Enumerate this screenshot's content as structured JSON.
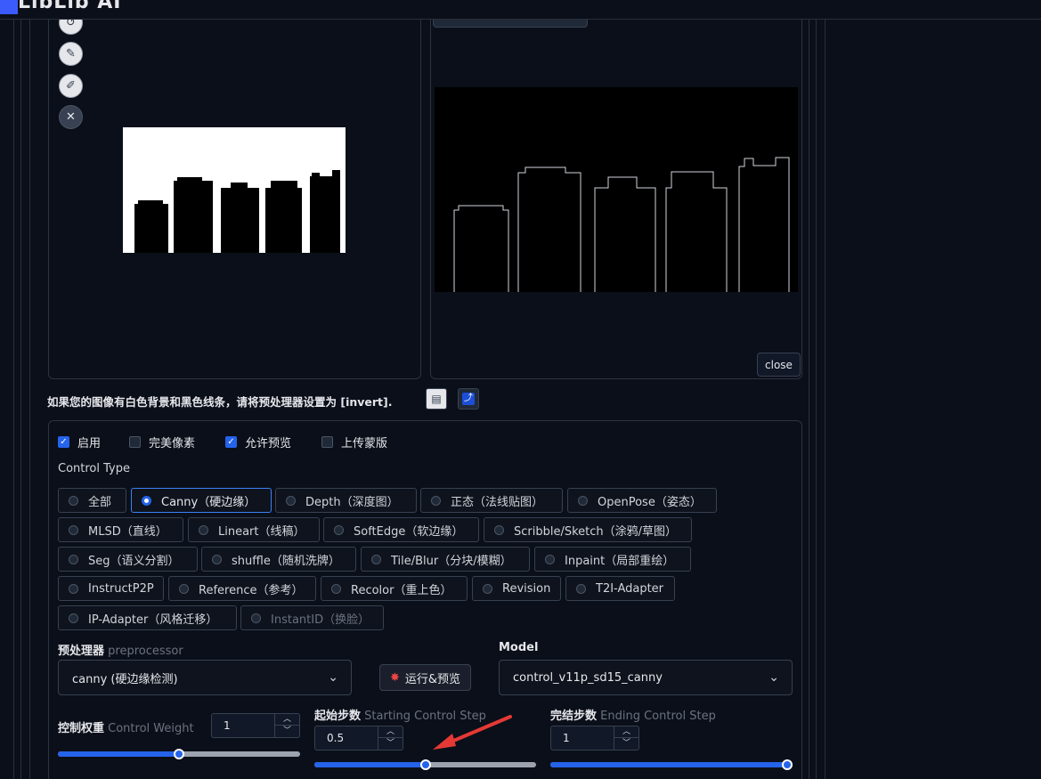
{
  "app": {
    "logo_text": "LibLib AI"
  },
  "image_panel": {
    "tools": [
      "undo-icon",
      "eraser-icon",
      "brush-icon",
      "close-icon"
    ]
  },
  "preview_panel": {
    "close_label": "close"
  },
  "hint": {
    "text": "如果您的图像有白色背景和黑色线条，请将预处理器设置为 [invert].",
    "icons": [
      "notes-icon",
      "swap-icon"
    ]
  },
  "checkboxes": [
    {
      "label": "启用",
      "checked": true
    },
    {
      "label": "完美像素",
      "checked": false
    },
    {
      "label": "允许预览",
      "checked": true
    },
    {
      "label": "上传蒙版",
      "checked": false
    }
  ],
  "control_type": {
    "label": "Control Type",
    "options": [
      {
        "label": "全部",
        "selected": false,
        "disabled": false
      },
      {
        "label": "Canny（硬边缘）",
        "selected": true,
        "disabled": false
      },
      {
        "label": "Depth（深度图）",
        "selected": false,
        "disabled": false
      },
      {
        "label": "正态（法线贴图）",
        "selected": false,
        "disabled": false
      },
      {
        "label": "OpenPose（姿态）",
        "selected": false,
        "disabled": false
      },
      {
        "label": "MLSD（直线）",
        "selected": false,
        "disabled": false
      },
      {
        "label": "Lineart（线稿）",
        "selected": false,
        "disabled": false
      },
      {
        "label": "SoftEdge（软边缘）",
        "selected": false,
        "disabled": false
      },
      {
        "label": "Scribble/Sketch（涂鸦/草图）",
        "selected": false,
        "disabled": false
      },
      {
        "label": "Seg（语义分割）",
        "selected": false,
        "disabled": false
      },
      {
        "label": "shuffle（随机洗牌）",
        "selected": false,
        "disabled": false
      },
      {
        "label": "Tile/Blur（分块/模糊）",
        "selected": false,
        "disabled": false
      },
      {
        "label": "Inpaint（局部重绘）",
        "selected": false,
        "disabled": false
      },
      {
        "label": "InstructP2P",
        "selected": false,
        "disabled": false
      },
      {
        "label": "Reference（参考）",
        "selected": false,
        "disabled": false
      },
      {
        "label": "Recolor（重上色）",
        "selected": false,
        "disabled": false
      },
      {
        "label": "Revision",
        "selected": false,
        "disabled": false
      },
      {
        "label": "T2I-Adapter",
        "selected": false,
        "disabled": false
      },
      {
        "label": "IP-Adapter（风格迁移）",
        "selected": false,
        "disabled": false
      },
      {
        "label": "InstantID（换脸）",
        "selected": false,
        "disabled": true
      }
    ]
  },
  "preprocessor": {
    "label_cn": "预处理器",
    "label_en": "preprocessor",
    "value": "canny (硬边缘检测)"
  },
  "run_button": {
    "label": "运行&预览"
  },
  "model": {
    "label": "Model",
    "value": "control_v11p_sd15_canny"
  },
  "control_weight": {
    "label_cn": "控制权重",
    "label_en": "Control Weight",
    "value": "1",
    "min": 0,
    "max": 2,
    "fraction": 0.5
  },
  "starting_step": {
    "label_cn": "起始步数",
    "label_en": "Starting Control Step",
    "value": "0.5",
    "fraction": 0.5
  },
  "ending_step": {
    "label_cn": "完结步数",
    "label_en": "Ending Control Step",
    "value": "1",
    "fraction": 1.0
  },
  "colors": {
    "accent": "#2563eb",
    "annotation_arrow": "#e53935",
    "background": "#0b0f19"
  }
}
